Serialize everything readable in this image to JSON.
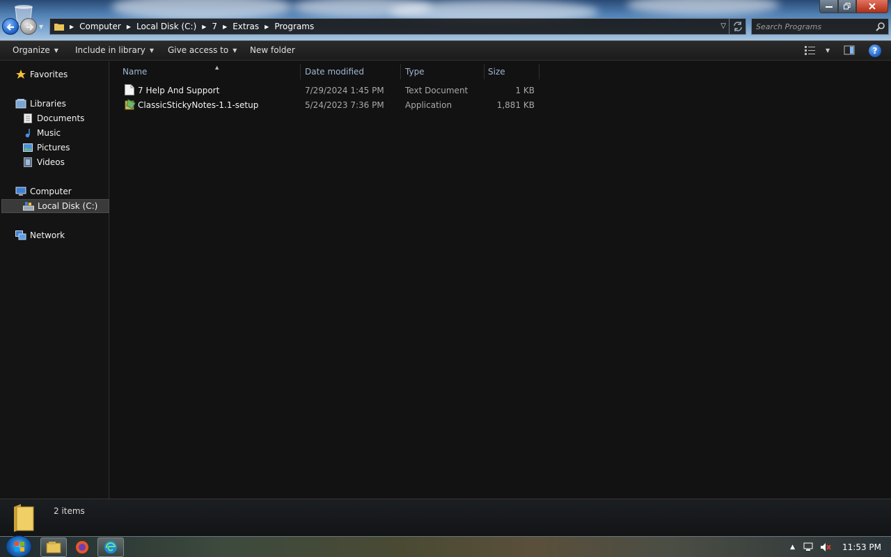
{
  "breadcrumb": [
    "Computer",
    "Local Disk (C:)",
    "7",
    "Extras",
    "Programs"
  ],
  "search": {
    "placeholder": "Search Programs"
  },
  "toolbar": {
    "organize": "Organize",
    "include_in_library": "Include in library",
    "give_access_to": "Give access to",
    "new_folder": "New folder"
  },
  "nav": {
    "favorites": "Favorites",
    "libraries": "Libraries",
    "documents": "Documents",
    "music": "Music",
    "pictures": "Pictures",
    "videos": "Videos",
    "computer": "Computer",
    "local_disk": "Local Disk (C:)",
    "network": "Network"
  },
  "columns": {
    "name": "Name",
    "date_modified": "Date modified",
    "type": "Type",
    "size": "Size"
  },
  "files": [
    {
      "name": "7 Help And Support",
      "date": "7/29/2024 1:45 PM",
      "type": "Text Document",
      "size": "1 KB",
      "icon": "text-document-icon"
    },
    {
      "name": "ClassicStickyNotes-1.1-setup",
      "date": "5/24/2023 7:36 PM",
      "type": "Application",
      "size": "1,881 KB",
      "icon": "installer-icon"
    }
  ],
  "details": {
    "item_count": "2 items"
  },
  "taskbar": {
    "clock": "11:53 PM",
    "apps": [
      "windows-explorer-icon",
      "firefox-icon",
      "edge-icon"
    ]
  },
  "colors": {
    "accent": "#1f6fc4",
    "close": "#c8432a",
    "header_text": "#9fb8d4"
  }
}
